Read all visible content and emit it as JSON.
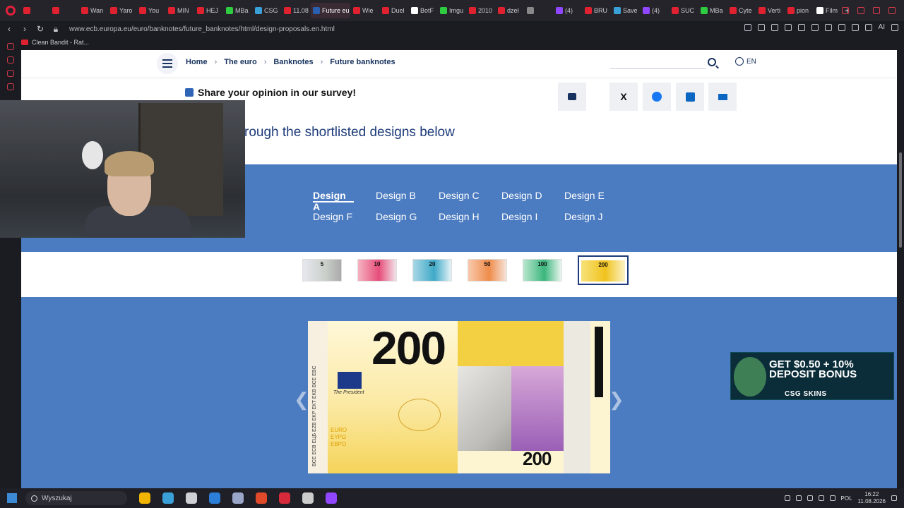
{
  "browser": {
    "tabs": [
      {
        "label": "",
        "color": "#e0212f"
      },
      {
        "label": "",
        "color": "#e0212f"
      },
      {
        "label": "Wan",
        "color": "#e0212f"
      },
      {
        "label": "Yaro",
        "color": "#e0212f"
      },
      {
        "label": "You",
        "color": "#e0212f"
      },
      {
        "label": "MIN",
        "color": "#e0212f"
      },
      {
        "label": "HEJ",
        "color": "#e0212f"
      },
      {
        "label": "MBa",
        "color": "#2ecc40"
      },
      {
        "label": "CSG",
        "color": "#3aa0d8"
      },
      {
        "label": "11.08",
        "color": "#e0212f"
      },
      {
        "label": "Future eu",
        "color": "#2b5fb0",
        "active": true
      },
      {
        "label": "Wie",
        "color": "#e0212f"
      },
      {
        "label": "Duel",
        "color": "#e0212f"
      },
      {
        "label": "BotF",
        "color": "#ffffff"
      },
      {
        "label": "Imgu",
        "color": "#2ecc40"
      },
      {
        "label": "2010",
        "color": "#e0212f"
      },
      {
        "label": "dzeł",
        "color": "#e0212f"
      },
      {
        "label": "",
        "color": "#888888"
      },
      {
        "label": "(4)",
        "color": "#9146ff"
      },
      {
        "label": "BRU",
        "color": "#e0212f"
      },
      {
        "label": "Save",
        "color": "#3aa0d8"
      },
      {
        "label": "(4)",
        "color": "#9146ff"
      },
      {
        "label": "SUC",
        "color": "#e0212f"
      },
      {
        "label": "MBa",
        "color": "#2ecc40"
      },
      {
        "label": "Cyte",
        "color": "#e0212f"
      },
      {
        "label": "Verti",
        "color": "#e0212f"
      },
      {
        "label": "pion",
        "color": "#e0212f"
      },
      {
        "label": "Film",
        "color": "#ffffff"
      }
    ],
    "new_tab": "+",
    "url": "www.ecb.europa.eu/euro/banknotes/future_banknotes/html/design-proposals.en.html",
    "bookmark": "Clean Bandit - Rat...",
    "ai_label": "AI"
  },
  "page": {
    "breadcrumbs": [
      "Home",
      "The euro",
      "Banknotes",
      "Future banknotes"
    ],
    "lang": "EN",
    "survey": "Share your opinion in our survey!",
    "heading": "rough the shortlisted designs below",
    "share_x": "X",
    "design_tabs": [
      "Design A",
      "Design B",
      "Design C",
      "Design D",
      "Design E",
      "Design F",
      "Design G",
      "Design H",
      "Design I",
      "Design J"
    ],
    "active_design": "Design A",
    "denominations": [
      "5",
      "10",
      "20",
      "50",
      "100",
      "200"
    ],
    "selected_denomination": "200",
    "note": {
      "value_top": "200",
      "value_bottom": "200",
      "president": "The President",
      "euro_text": "EURO\nΕΥΡΩ\nЕВРО",
      "vertical_text": "BCE ECB ЕЦБ EZB EKP EKT EKB BCE EBC"
    },
    "ad": {
      "line1": "GET $0.50 + 10%",
      "line2": "DEPOSIT BONUS",
      "brand": "CSG SKINS"
    }
  },
  "taskbar": {
    "search_placeholder": "Wyszukaj",
    "lang": "POL",
    "time": "16:22",
    "date": "11.08.2026",
    "app_colors": [
      "#f0b400",
      "#3aa0d8",
      "#cfcfd6",
      "#2b7fd8",
      "#9aa6c8",
      "#e04a2a",
      "#d62a3a",
      "#cccccc",
      "#9146ff"
    ]
  },
  "colors": {
    "brand_blue": "#1d3a7a",
    "band": "#4b7bc0",
    "opera_red": "#e2213a"
  }
}
